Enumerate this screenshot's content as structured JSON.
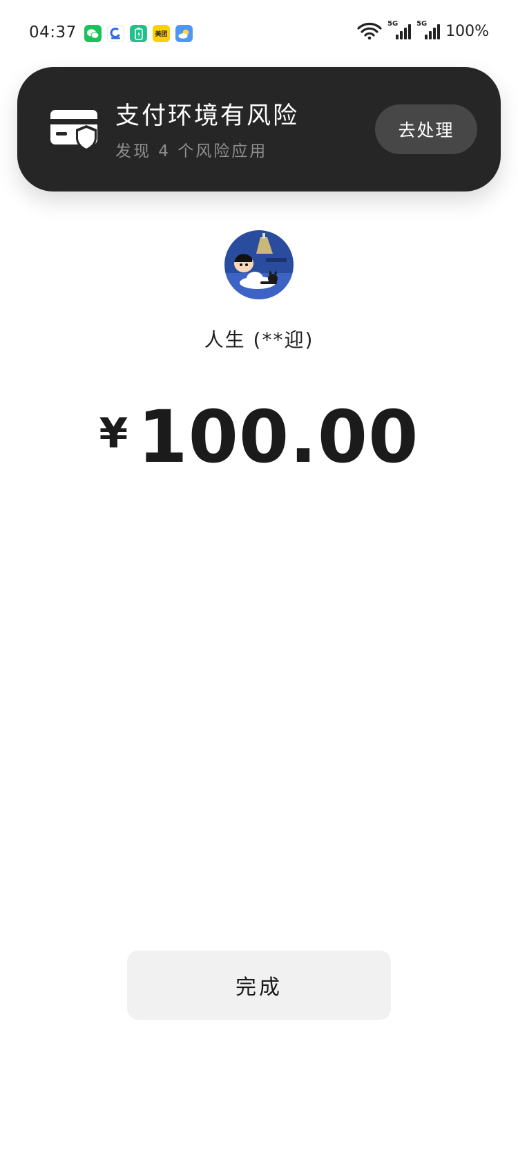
{
  "status_bar": {
    "time": "04:37",
    "app_icons": [
      "wechat-icon",
      "alipay-like-icon",
      "battery-app-icon",
      "meituan-icon",
      "weather-icon"
    ],
    "meituan_label": "美团",
    "network_1": "5G",
    "network_2": "5G",
    "battery": "100%"
  },
  "risk_notification": {
    "title": "支付环境有风险",
    "subtitle": "发现 4 个风险应用",
    "action_label": "去处理",
    "icon": "card-shield-icon",
    "background": "#262626"
  },
  "payee": {
    "name": "人生 (**迎)",
    "avatar": "cartoon-avatar"
  },
  "payment": {
    "currency_symbol": "¥",
    "amount": "100.00"
  },
  "actions": {
    "done_label": "完成"
  },
  "colors": {
    "done_bg": "#f1f1f1",
    "action_bg": "#474747"
  }
}
